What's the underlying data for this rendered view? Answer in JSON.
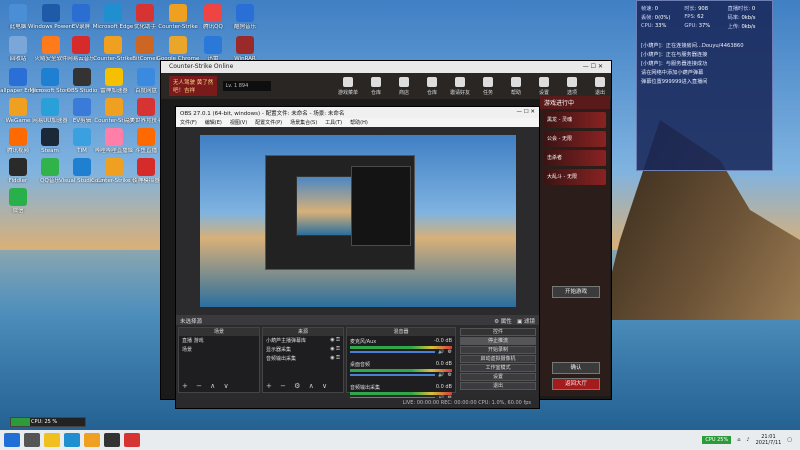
{
  "desktop_icons": [
    {
      "label": "此电脑",
      "color": "#4a8fd6"
    },
    {
      "label": "Windows Powershell",
      "color": "#1e5aa8"
    },
    {
      "label": "EV录屏",
      "color": "#2b6ed1"
    },
    {
      "label": "Microsoft Edge",
      "color": "#1f8fd0"
    },
    {
      "label": "优化助手",
      "color": "#d63333"
    },
    {
      "label": "Counter-Strike",
      "color": "#f0a020"
    },
    {
      "label": "腾讯QQ",
      "color": "#e44"
    },
    {
      "label": "酷狗音乐",
      "color": "#2a6fd6"
    },
    {
      "label": "回收站",
      "color": "#7aa7d8"
    },
    {
      "label": "火绒安全软件",
      "color": "#ff7a1a"
    },
    {
      "label": "网易云音乐",
      "color": "#d72b2b"
    },
    {
      "label": "Counter-Strike",
      "color": "#f0a020"
    },
    {
      "label": "BitComet",
      "color": "#c62"
    },
    {
      "label": "Google Chrome",
      "color": "#e9a62a"
    },
    {
      "label": "迅雷",
      "color": "#2a78d8"
    },
    {
      "label": "WinRAR",
      "color": "#9a2a2a"
    },
    {
      "label": "Wallpaper Engine",
      "color": "#2a6fd6"
    },
    {
      "label": "Microsoft Store",
      "color": "#1f7fd0"
    },
    {
      "label": "OBS Studio",
      "color": "#333"
    },
    {
      "label": "雷神加速器",
      "color": "#f5c000"
    },
    {
      "label": "百度网盘",
      "color": "#3a8ae0"
    },
    {
      "label": "WeGame",
      "color": "#f0a020"
    },
    {
      "label": "网易UU加速器",
      "color": "#2aa0d8"
    },
    {
      "label": "EV剪辑",
      "color": "#3a7ad8"
    },
    {
      "label": "Counter-Strike",
      "color": "#f0a020"
    },
    {
      "label": "完美世界竞技平台",
      "color": "#d63333"
    },
    {
      "label": "腾讯视频",
      "color": "#ff6a00"
    },
    {
      "label": "Steam",
      "color": "#1b2838"
    },
    {
      "label": "TIM",
      "color": "#3aa0e0"
    },
    {
      "label": "哔哩哔哩直播姬",
      "color": "#ff7fa8"
    },
    {
      "label": "斗鱼直播",
      "color": "#ff6a00"
    },
    {
      "label": "Fiddler",
      "color": "#2a2a2a"
    },
    {
      "label": "QQ音乐",
      "color": "#32b24a"
    },
    {
      "label": "Visual Studio Code",
      "color": "#1f7fd0"
    },
    {
      "label": "Counter-Strike Global",
      "color": "#f0a020"
    },
    {
      "label": "夜神模拟器",
      "color": "#d72b2b"
    },
    {
      "label": "微信",
      "color": "#2ab04a"
    }
  ],
  "game_window": {
    "title": "Counter-Strike Online",
    "logo": "无人驾驶 黄了然吧！吉祥",
    "level": "Lv. 1 894",
    "nav_items": [
      "游戏菜单",
      "仓库",
      "商店",
      "仓库",
      "邀请好友",
      "任务",
      "帮助",
      "设置",
      "选项",
      "退出"
    ],
    "panel_title": "游戏进行中",
    "start_button": "开始游戏",
    "side_buttons": [
      "确认",
      "返回大厅"
    ],
    "room_rows": [
      "黑龙 - 灵魂",
      "公会 - 无限",
      "击杀者",
      "大乱斗 - 无限"
    ]
  },
  "obs": {
    "title": "OBS 27.0.1 (64-bit, windows) - 配置文件: 未命名 - 场景: 未命名",
    "menu": [
      "文件(F)",
      "编辑(E)",
      "视图(V)",
      "配置文件(P)",
      "场景集合(S)",
      "工具(T)",
      "帮助(H)"
    ],
    "no_source": "未选择源",
    "props_label": "属性",
    "filters_label": "滤镜",
    "scenes_header": "场景",
    "scenes": [
      "直播 游戏",
      "场景"
    ],
    "sources_header": "来源",
    "sources": [
      "小葫芦主播弹幕库",
      "显示器采集",
      "音频输出采集"
    ],
    "mixer_header": "混音器",
    "mixer": [
      {
        "name": "麦克风/Aux",
        "db": "-0.0 dB"
      },
      {
        "name": "桌面音频",
        "db": "0.0 dB"
      },
      {
        "name": "音频输出采集",
        "db": "0.0 dB"
      }
    ],
    "controls_header": "控件",
    "controls": [
      "停止推流",
      "开始录制",
      "启动虚拟摄像机",
      "工作室模式",
      "设置",
      "退出"
    ],
    "status": "LIVE: 00:00:00   REC: 00:00:00   CPU: 1.0%, 60.00 fps"
  },
  "stats_overlay": {
    "cells": [
      [
        "帧速:",
        "0",
        "时长:",
        "908",
        "直播时长:",
        "0"
      ],
      [
        "丢帧:",
        "0(0%)",
        "FPS:",
        "62",
        "码率:",
        "0kb/s"
      ],
      [
        "CPU:",
        "33%",
        "GPU:",
        "37%",
        "上传:",
        "0kb/s"
      ]
    ],
    "messages": [
      "[小葫芦]：正在连接房间...Douyu/4463860",
      "[小葫芦]：正在与服务器连接",
      "[小葫芦]：与服务器连接成功",
      "请在网络中添加小葫芦弹幕",
      "弹幕位置999999进入直播间"
    ]
  },
  "cpu_widget": {
    "label": "CPU: 25 %",
    "percent": 25
  },
  "taskbar": {
    "apps": [
      "start",
      "search",
      "file-explorer",
      "edge",
      "counter-strike",
      "obs",
      "game"
    ],
    "cpu_chip": "CPU 25%",
    "time": "21:01",
    "date": "2021/7/11",
    "colors": {
      "start": "#1f6fd6",
      "accent": "#2e9b3a"
    }
  }
}
